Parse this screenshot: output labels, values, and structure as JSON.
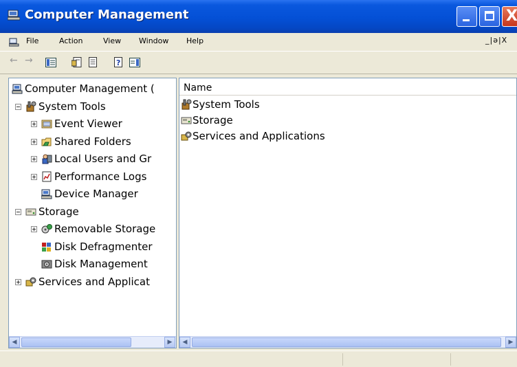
{
  "window": {
    "title": "Computer Management",
    "close_glyph": "X"
  },
  "menu": {
    "items": [
      "File",
      "Action",
      "View",
      "Window",
      "Help"
    ],
    "mdi_controls": "_|ə|X"
  },
  "toolbar": {
    "back_icon": "back-arrow-icon",
    "forward_icon": "forward-arrow-icon"
  },
  "tree": {
    "items": [
      {
        "label": "Computer Management (",
        "icon": "computer-management-icon",
        "level": 0,
        "expander": "none"
      },
      {
        "label": "System Tools",
        "icon": "system-tools-icon",
        "level": 1,
        "expander": "minus"
      },
      {
        "label": "Event Viewer",
        "icon": "event-viewer-icon",
        "level": 2,
        "expander": "plus"
      },
      {
        "label": "Shared Folders",
        "icon": "shared-folders-icon",
        "level": 2,
        "expander": "plus"
      },
      {
        "label": "Local Users and Gr",
        "icon": "local-users-icon",
        "level": 2,
        "expander": "plus"
      },
      {
        "label": "Performance Logs",
        "icon": "performance-logs-icon",
        "level": 2,
        "expander": "plus"
      },
      {
        "label": "Device Manager",
        "icon": "device-manager-icon",
        "level": 2,
        "expander": "none"
      },
      {
        "label": "Storage",
        "icon": "storage-icon",
        "level": 1,
        "expander": "minus"
      },
      {
        "label": "Removable Storage",
        "icon": "removable-storage-icon",
        "level": 2,
        "expander": "plus"
      },
      {
        "label": "Disk Defragmenter",
        "icon": "disk-defragmenter-icon",
        "level": 2,
        "expander": "none"
      },
      {
        "label": "Disk Management",
        "icon": "disk-management-icon",
        "level": 2,
        "expander": "none"
      },
      {
        "label": "Services and Applicat",
        "icon": "services-applications-icon",
        "level": 1,
        "expander": "plus"
      }
    ]
  },
  "list": {
    "column_header": "Name",
    "items": [
      {
        "label": "System Tools",
        "icon": "system-tools-icon"
      },
      {
        "label": "Storage",
        "icon": "storage-icon"
      },
      {
        "label": "Services and Applications",
        "icon": "services-applications-icon"
      }
    ]
  },
  "colors": {
    "titlebar": "#0450d6",
    "face": "#ece9d8",
    "pane_border": "#7f9db9"
  }
}
